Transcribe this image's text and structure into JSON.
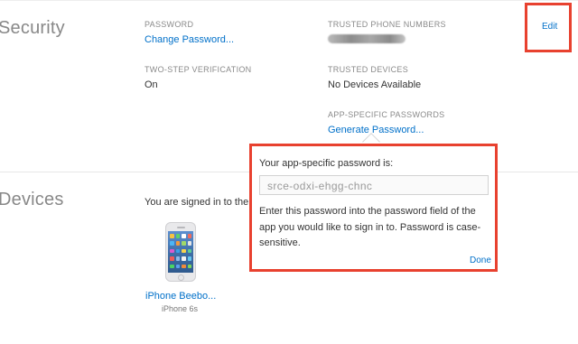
{
  "security": {
    "title": "Security",
    "password_label": "PASSWORD",
    "change_password": "Change Password...",
    "two_step_label": "TWO-STEP VERIFICATION",
    "two_step_value": "On",
    "trusted_phone_label": "TRUSTED PHONE NUMBERS",
    "trusted_devices_label": "TRUSTED DEVICES",
    "trusted_devices_value": "No Devices Available",
    "app_passwords_label": "APP-SPECIFIC PASSWORDS",
    "generate_password": "Generate Password...",
    "edit": "Edit"
  },
  "devices": {
    "title": "Devices",
    "signed_in_text": "You are signed in to the",
    "items": [
      {
        "name": "iPhone Beebo...",
        "model": "iPhone 6s"
      }
    ]
  },
  "popover": {
    "title": "Your app-specific password is:",
    "password": "srce-odxi-ehgg-chnc",
    "instructions": "Enter this password into the password field of the app you would like to sign in to. Password is case-sensitive.",
    "done": "Done"
  },
  "colors": {
    "link": "#0070c9",
    "highlight": "#e8412f",
    "section_title": "#888888"
  }
}
